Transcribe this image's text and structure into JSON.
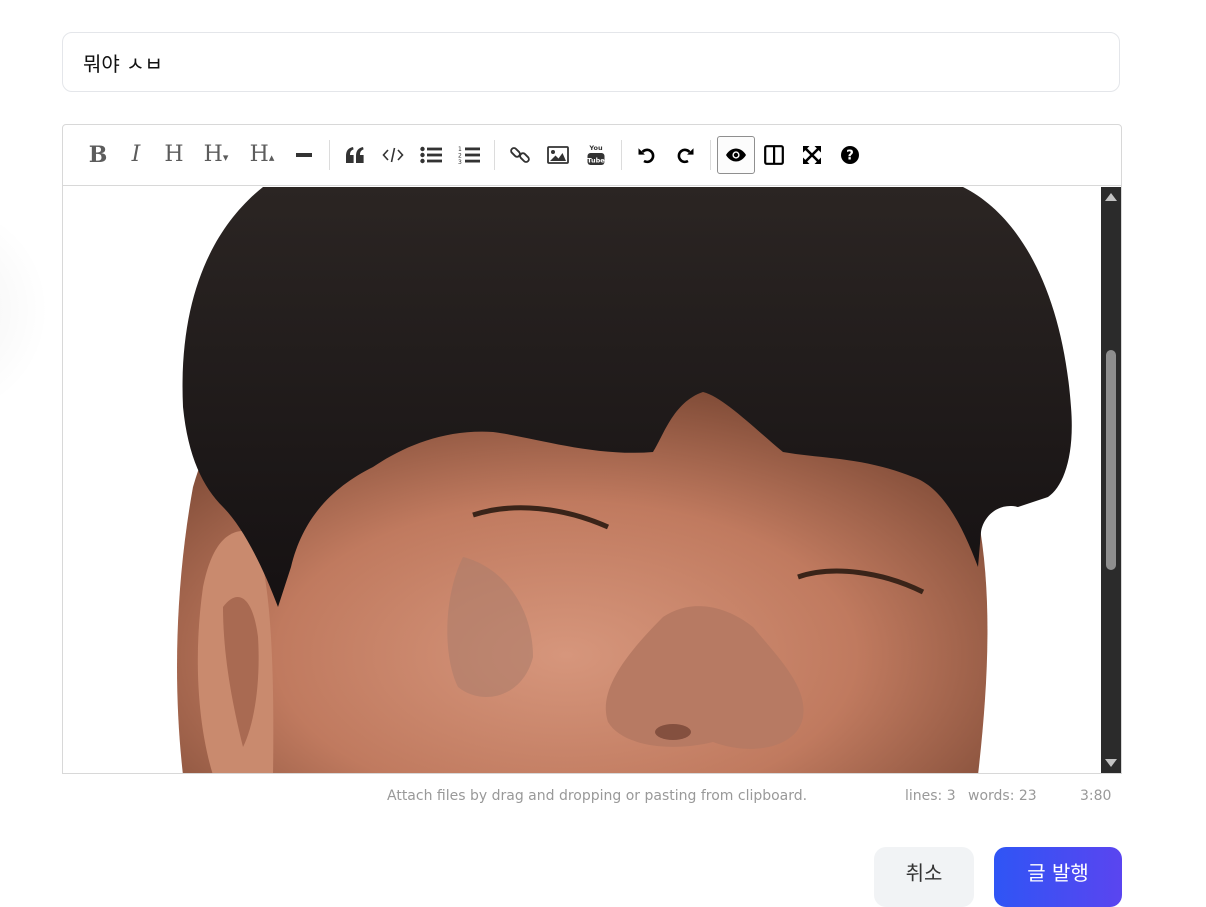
{
  "title_field": {
    "value": "뭐야 ㅅㅂ"
  },
  "toolbar": {
    "items": [
      {
        "name": "bold",
        "glyph": "B"
      },
      {
        "name": "italic",
        "glyph": "I"
      },
      {
        "name": "heading",
        "glyph": "H"
      },
      {
        "name": "heading-smaller",
        "glyph": "H▾"
      },
      {
        "name": "heading-bigger",
        "glyph": "H▴"
      },
      {
        "name": "horizontal-rule"
      },
      {
        "name": "quote"
      },
      {
        "name": "code"
      },
      {
        "name": "unordered-list"
      },
      {
        "name": "ordered-list"
      },
      {
        "name": "link"
      },
      {
        "name": "image"
      },
      {
        "name": "youtube"
      },
      {
        "name": "undo"
      },
      {
        "name": "redo"
      },
      {
        "name": "preview",
        "active": true
      },
      {
        "name": "side-by-side"
      },
      {
        "name": "fullscreen"
      },
      {
        "name": "guide"
      }
    ],
    "youtube_text": "You Tube"
  },
  "editor": {
    "image_alt": "smiling person photo"
  },
  "statusbar": {
    "hint": "Attach files by drag and dropping or pasting from clipboard.",
    "lines": "lines: 3",
    "words": "words: 23",
    "cursor": "3:80"
  },
  "actions": {
    "cancel_label": "취소",
    "publish_label": "글 발행"
  }
}
